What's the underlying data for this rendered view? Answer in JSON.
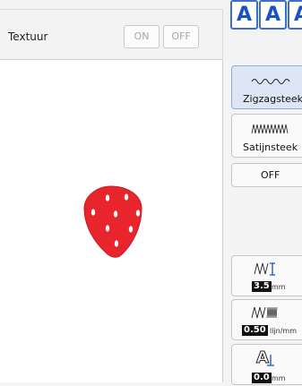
{
  "texture": {
    "label": "Textuur",
    "on_label": "ON",
    "off_label": "OFF"
  },
  "font_buttons": [
    "A",
    "A",
    "A"
  ],
  "stitch_types": [
    {
      "label": "Zigzagsteek",
      "active": true
    },
    {
      "label": "Satijnsteek",
      "active": false
    }
  ],
  "stitch_off_label": "OFF",
  "params": {
    "width": {
      "value": "3.5",
      "unit": "mm"
    },
    "density": {
      "value": "0.50",
      "unit": "lijn/mm"
    },
    "offset": {
      "value": "0.0",
      "unit": "mm"
    }
  },
  "colors": {
    "accent": "#1a52c7",
    "embroidery": "#e8242d"
  }
}
